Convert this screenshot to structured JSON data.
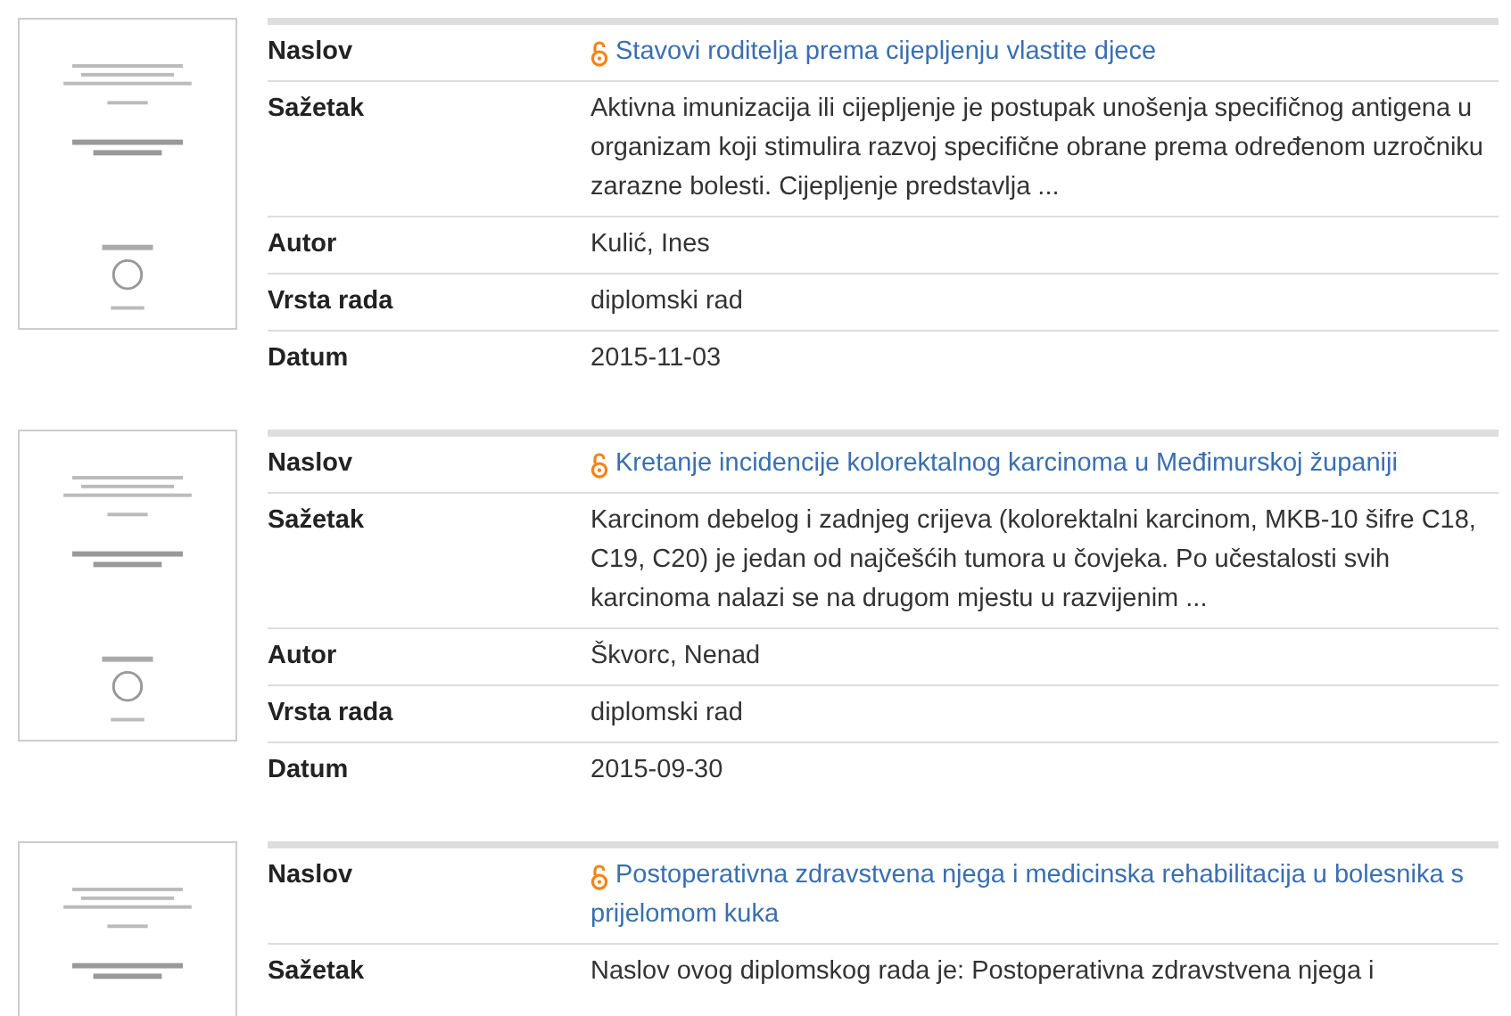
{
  "records": [
    {
      "fields": [
        {
          "label": "Naslov",
          "kind": "title",
          "value": "Stavovi roditelja prema cijepljenju vlastite djece",
          "open_access": true
        },
        {
          "label": "Sažetak",
          "kind": "text",
          "value": "Aktivna imunizacija ili cijepljenje je postupak unošenja specifičnog antigena u organizam koji stimulira razvoj specifične obrane prema određenom uzročniku zarazne bolesti. Cijepljenje predstavlja ..."
        },
        {
          "label": "Autor",
          "kind": "text",
          "value": "Kulić, Ines"
        },
        {
          "label": "Vrsta rada",
          "kind": "text",
          "value": "diplomski rad"
        },
        {
          "label": "Datum",
          "kind": "text",
          "value": "2015-11-03"
        }
      ]
    },
    {
      "fields": [
        {
          "label": "Naslov",
          "kind": "title",
          "value": "Kretanje incidencije kolorektalnog karcinoma u Međimurskoj županiji",
          "open_access": true
        },
        {
          "label": "Sažetak",
          "kind": "text",
          "value": "Karcinom debelog i zadnjeg crijeva (kolorektalni karcinom, MKB-10 šifre C18, C19, C20) je jedan od najčešćih tumora u čovjeka. Po učestalosti svih karcinoma nalazi se na drugom mjestu u razvijenim ..."
        },
        {
          "label": "Autor",
          "kind": "text",
          "value": "Škvorc, Nenad"
        },
        {
          "label": "Vrsta rada",
          "kind": "text",
          "value": "diplomski rad"
        },
        {
          "label": "Datum",
          "kind": "text",
          "value": "2015-09-30"
        }
      ]
    },
    {
      "fields": [
        {
          "label": "Naslov",
          "kind": "title",
          "value": "Postoperativna zdravstvena njega i medicinska rehabilitacija u bolesnika s prijelomom kuka",
          "open_access": true
        },
        {
          "label": "Sažetak",
          "kind": "text",
          "value": "Naslov ovog diplomskog rada je: Postoperativna zdravstvena njega i"
        }
      ]
    }
  ]
}
